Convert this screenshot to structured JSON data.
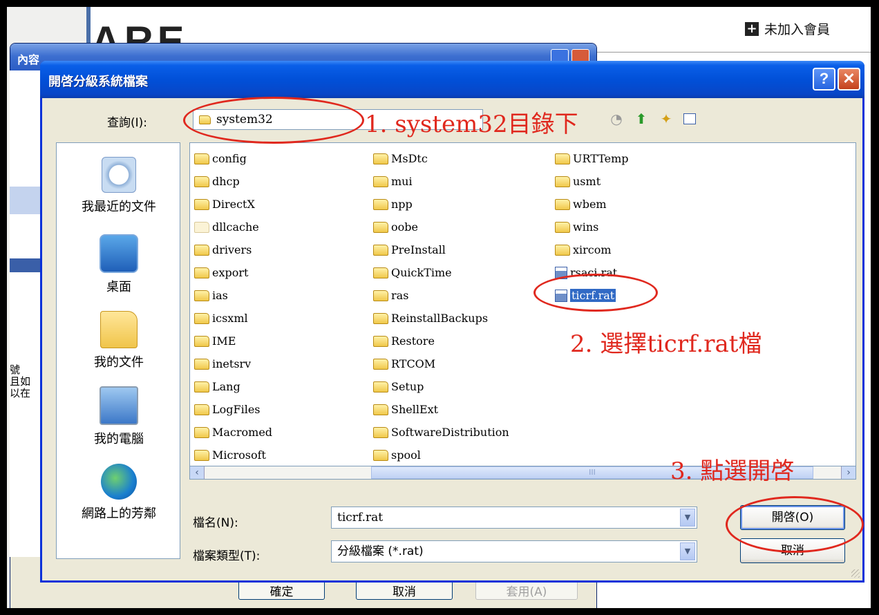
{
  "background": {
    "site_logo": "ARE",
    "member_link": "未加入會員",
    "behind_dialog": {
      "title": "內容",
      "side_text": "號\n且如\n以在",
      "buttons": [
        "確定",
        "取消",
        "套用(A)"
      ]
    }
  },
  "dialog": {
    "title": "開啓分級系統檔案",
    "help_label": "?",
    "close_label": "✕",
    "look_in_label": "查詢(I):",
    "look_in_value": "system32",
    "places": [
      "我最近的文件",
      "桌面",
      "我的文件",
      "我的電腦",
      "網路上的芳鄰"
    ],
    "files": {
      "col1": [
        "config",
        "dhcp",
        "DirectX",
        "dllcache",
        "drivers",
        "export",
        "ias",
        "icsxml",
        "IME",
        "inetsrv",
        "Lang",
        "LogFiles",
        "Macromed",
        "Microsoft"
      ],
      "col2": [
        "MsDtc",
        "mui",
        "npp",
        "oobe",
        "PreInstall",
        "QuickTime",
        "ras",
        "ReinstallBackups",
        "Restore",
        "RTCOM",
        "Setup",
        "ShellExt",
        "SoftwareDistribution",
        "spool"
      ],
      "col3": [
        "URTTemp",
        "usmt",
        "wbem",
        "wins",
        "xircom"
      ],
      "col3_files": [
        "rsaci.rat",
        "ticrf.rat"
      ]
    },
    "scroll_thumb_label": "III",
    "filename_label": "檔名(N):",
    "filename_value": "ticrf.rat",
    "filetype_label": "檔案類型(T):",
    "filetype_value": "分級檔案 (*.rat)",
    "open_button": "開啓(O)",
    "cancel_button": "取消"
  },
  "annotations": {
    "step1": "1. system32目錄下",
    "step2": "2. 選擇ticrf.rat檔",
    "step3": "3. 點選開啓"
  },
  "colors": {
    "titlebar": "#0150d8",
    "annotation_red": "#e0281e",
    "selection": "#316ac5"
  }
}
